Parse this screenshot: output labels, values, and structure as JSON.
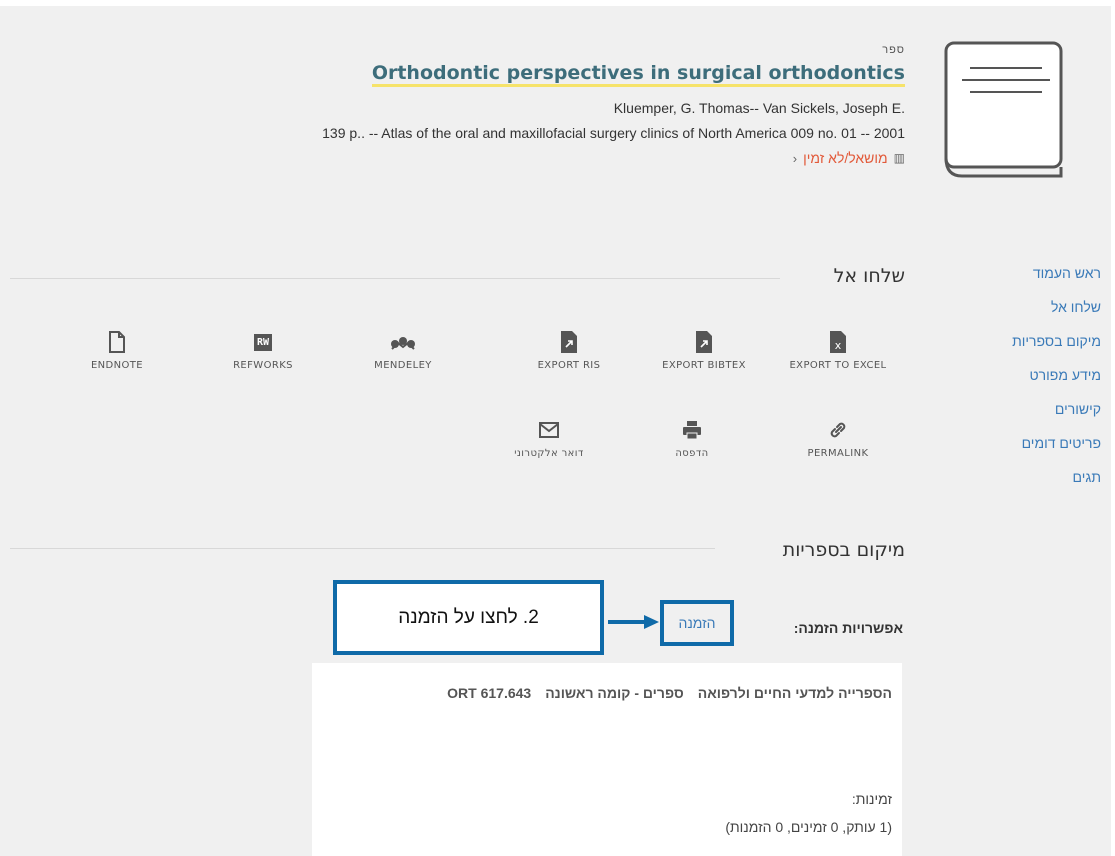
{
  "record": {
    "type_label": "ספר",
    "title": "Orthodontic perspectives in surgical orthodontics",
    "authors": "Kluemper, G. Thomas-- Van Sickels, Joseph E.",
    "details": "139 p.. -- Atlas of the oral and maxillofacial surgery clinics of North America 009 no. 01 -- 2001",
    "availability": "מושאל/לא זמין",
    "availability_color": "#e25a3a"
  },
  "sidenav": {
    "items": [
      {
        "label": "ראש העמוד"
      },
      {
        "label": "שלחו אל"
      },
      {
        "label": "מיקום בספריות"
      },
      {
        "label": "מידע מפורט"
      },
      {
        "label": "קישורים"
      },
      {
        "label": "פריטים דומים"
      },
      {
        "label": "תגים"
      }
    ]
  },
  "send_to": {
    "title": "שלחו אל",
    "row1": [
      {
        "label": "EXPORT TO EXCEL",
        "icon": "excel-file-icon"
      },
      {
        "label": "EXPORT BIBTEX",
        "icon": "export-file-icon"
      },
      {
        "label": "EXPORT RIS",
        "icon": "export-file-icon"
      },
      {
        "label": "MENDELEY",
        "icon": "mendeley-icon"
      },
      {
        "label": "REFWORKS",
        "icon": "refworks-icon",
        "badge": "RW"
      },
      {
        "label": "ENDNOTE",
        "icon": "document-icon"
      }
    ],
    "row2": [
      {
        "label": "PERMALINK",
        "icon": "link-icon"
      },
      {
        "label": "הדפסה",
        "icon": "printer-icon"
      },
      {
        "label": "דואר אלקטרוני",
        "icon": "envelope-icon"
      }
    ]
  },
  "locations": {
    "title": "מיקום בספריות",
    "request_options_label": "אפשרויות הזמנה:",
    "request_link": "הזמנה",
    "callout": "2. לחצו על הזמנה",
    "callout_color": "#0f6aa8",
    "holding": {
      "library": "הספרייה למדעי החיים ולרפואה",
      "location": "ספרים - קומה ראשונה",
      "call_number": "ORT 617.643"
    },
    "availability_label": "זמינות:",
    "availability_value": "(1 עותק, 0 זמינים, 0 הזמנות)"
  }
}
